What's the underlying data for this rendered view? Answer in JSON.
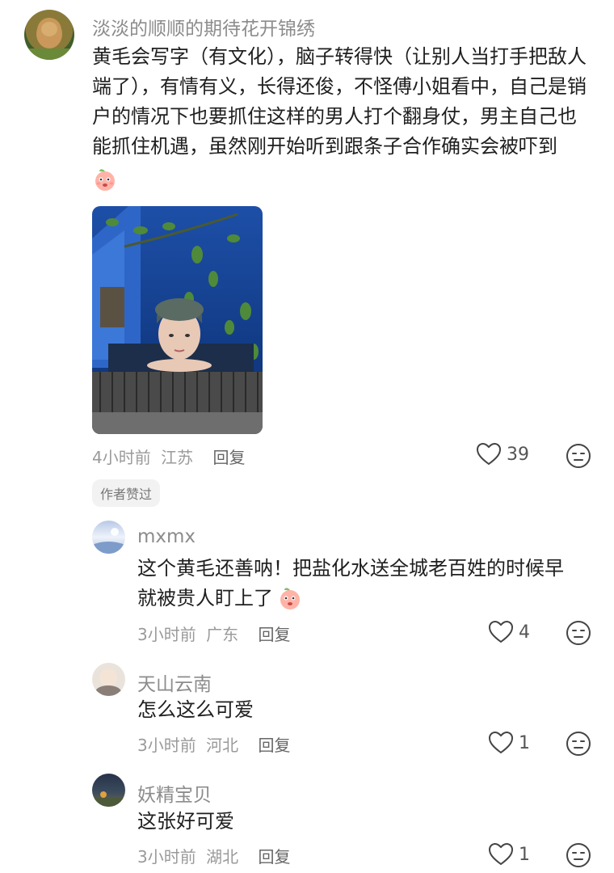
{
  "main_comment": {
    "username": "淡淡的顺顺的期待花开锦绣",
    "text": "黄毛会写字（有文化），脑子转得快（让别人当打手把敌人端了），有情有义，长得还俊，不怪傅小姐看中，自己是销户的情况下也要抓住这样的男人打个翻身仗，男主自己也能抓住机遇，虽然刚开始听到跟条子合作确实会被吓到",
    "emoji_icon": "peach-face-emoji",
    "image_icon": "portrait-photo",
    "time": "4小时前",
    "location": "江苏",
    "reply_label": "回复",
    "likes": "39",
    "badge": "作者赞过"
  },
  "replies": [
    {
      "username": "mxmx",
      "text": "这个黄毛还善呐！把盐化水送全城老百姓的时候早就被贵人盯上了",
      "time": "3小时前",
      "location": "广东",
      "reply_label": "回复",
      "likes": "4"
    },
    {
      "username": "天山云南",
      "text": "怎么这么可爱",
      "time": "3小时前",
      "location": "河北",
      "reply_label": "回复",
      "likes": "1"
    },
    {
      "username": "妖精宝贝",
      "text": "这张好可爱",
      "time": "3小时前",
      "location": "湖北",
      "reply_label": "回复",
      "likes": "1"
    }
  ],
  "colors": {
    "heart": "#444444",
    "meta": "#9a9a9a",
    "name": "#8c8c8c"
  }
}
